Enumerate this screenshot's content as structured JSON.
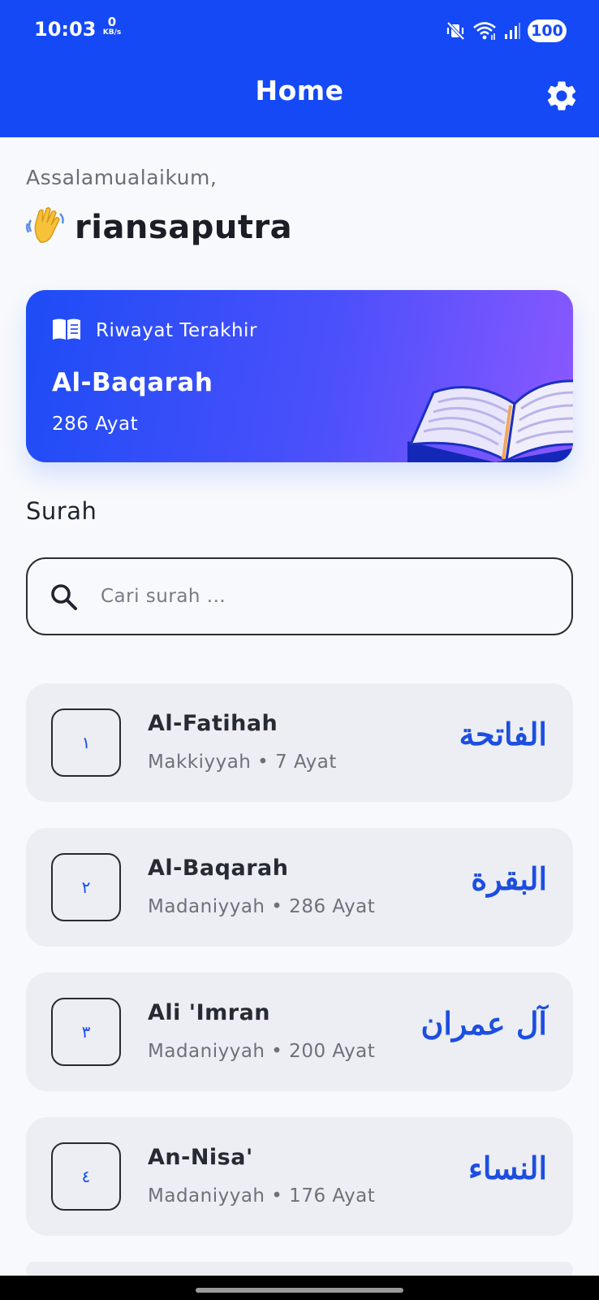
{
  "status_bar": {
    "time": "10:03",
    "net_speed_value": "0",
    "net_speed_unit": "KB/s",
    "battery": "100",
    "icons": [
      "vibrate-off-icon",
      "wifi-icon",
      "signal-icon"
    ]
  },
  "header": {
    "title": "Home",
    "settings_icon": "gear-icon",
    "background_color": "#1449f5"
  },
  "greeting": {
    "salutation": "Assalamualaikum,",
    "emoji": "👋",
    "user_name": "riansaputra"
  },
  "last_read": {
    "label": "Riwayat Terakhir",
    "surah": "Al-Baqarah",
    "ayat": "286 Ayat",
    "icon": "open-book-icon"
  },
  "surah_section": {
    "title": "Surah"
  },
  "search": {
    "placeholder": "Cari surah ...",
    "value": ""
  },
  "surahs": [
    {
      "number": "١",
      "name": "Al-Fatihah",
      "meta": "Makkiyyah • 7 Ayat",
      "arabic": "الفاتحة"
    },
    {
      "number": "٢",
      "name": "Al-Baqarah",
      "meta": "Madaniyyah • 286 Ayat",
      "arabic": "البقرة"
    },
    {
      "number": "٣",
      "name": "Ali 'Imran",
      "meta": "Madaniyyah • 200 Ayat",
      "arabic": "آل عمران"
    },
    {
      "number": "٤",
      "name": "An-Nisa'",
      "meta": "Madaniyyah • 176 Ayat",
      "arabic": "النساء"
    }
  ],
  "colors": {
    "accent": "#1449f5",
    "card_gradient_start": "#1d4cf6",
    "card_gradient_end": "#8b58ff",
    "arabic_text": "#1d4ee0"
  }
}
